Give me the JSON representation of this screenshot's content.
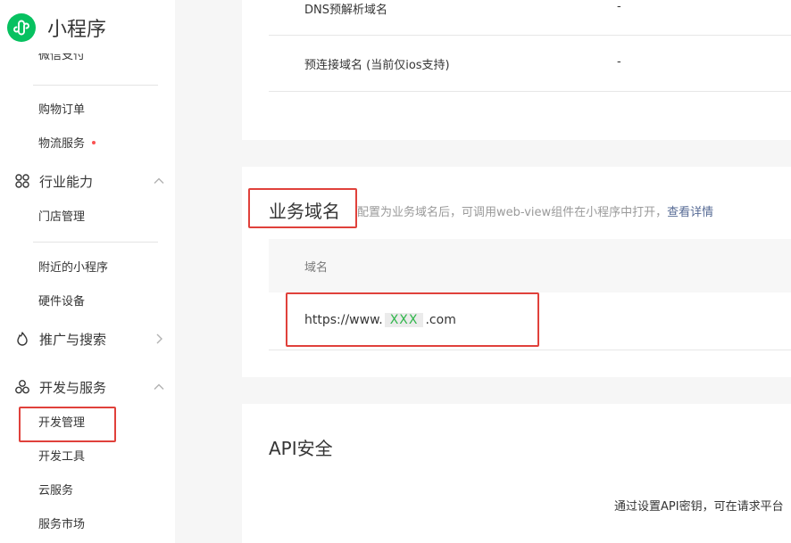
{
  "app": {
    "title": "小程序"
  },
  "sidebar": {
    "items_top": [
      {
        "label": "微信支付",
        "partial": true
      },
      {
        "label": "购物订单"
      },
      {
        "label": "物流服务",
        "dot": true
      }
    ],
    "groups": [
      {
        "label": "行业能力",
        "icon": "industry-icon",
        "chevron": "up",
        "items": [
          "门店管理",
          "附近的小程序",
          "硬件设备"
        ]
      },
      {
        "label": "推广与搜索",
        "icon": "promotion-icon",
        "chevron": "right",
        "items": []
      },
      {
        "label": "开发与服务",
        "icon": "dev-service-icon",
        "chevron": "up",
        "items": [
          "开发管理",
          "开发工具",
          "云服务",
          "服务市场"
        ]
      }
    ]
  },
  "main": {
    "domain_rows": [
      {
        "label": "DNS预解析域名",
        "value": "-"
      },
      {
        "label": "预连接域名 (当前仅ios支持)",
        "value": "-"
      }
    ],
    "business_domain": {
      "title": "业务域名",
      "description": "配置为业务域名后，可调用web-view组件在小程序中打开，",
      "link": "查看详情",
      "column_header": "域名",
      "url_prefix": "https://www.",
      "url_masked": "XXX",
      "url_suffix": ".com"
    },
    "api_security": {
      "title": "API安全",
      "description": "通过设置API密钥，可在请求平台"
    }
  },
  "colors": {
    "brand": "#07c160",
    "highlight_box": "#e0413b",
    "link": "#576b95",
    "notice_dot": "#fa5151"
  }
}
